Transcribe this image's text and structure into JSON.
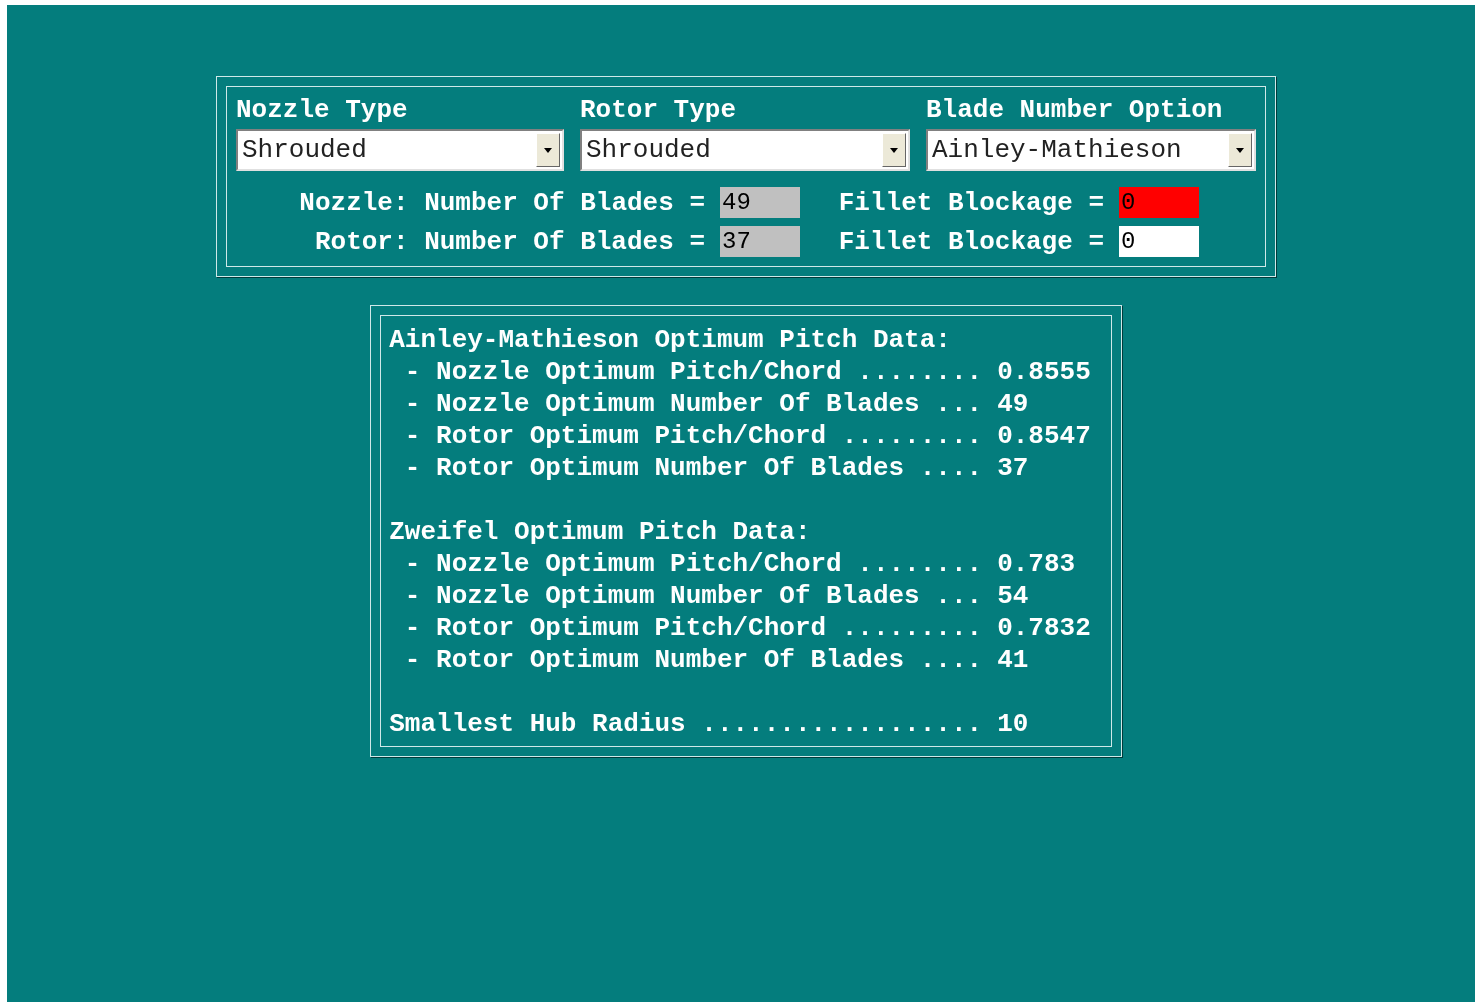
{
  "selectors": [
    {
      "label": "Nozzle Type",
      "value": "Shrouded"
    },
    {
      "label": "Rotor Type",
      "value": "Shrouded"
    },
    {
      "label": "Blade Number Option",
      "value": "Ainley-Mathieson"
    }
  ],
  "blade_rows": [
    {
      "label": "Nozzle: Number Of Blades =",
      "blades": {
        "value": "49",
        "disabled": true
      },
      "fillet_label": "Fillet Blockage =",
      "fillet": {
        "value": "0",
        "error": true
      }
    },
    {
      "label": "Rotor: Number Of Blades =",
      "blades": {
        "value": "37",
        "disabled": true
      },
      "fillet_label": "Fillet Blockage =",
      "fillet": {
        "value": "0",
        "error": false
      }
    }
  ],
  "results": {
    "sections": [
      {
        "title": "Ainley-Mathieson Optimum Pitch Data:",
        "rows": [
          {
            "label": "- Nozzle Optimum Pitch/Chord ........",
            "value": "0.8555"
          },
          {
            "label": "- Nozzle Optimum Number Of Blades ...",
            "value": "49"
          },
          {
            "label": "- Rotor Optimum Pitch/Chord .........",
            "value": "0.8547"
          },
          {
            "label": "- Rotor Optimum Number Of Blades ....",
            "value": "37"
          }
        ]
      },
      {
        "title": "Zweifel Optimum Pitch Data:",
        "rows": [
          {
            "label": "- Nozzle Optimum Pitch/Chord ........",
            "value": "0.783"
          },
          {
            "label": "- Nozzle Optimum Number Of Blades ...",
            "value": "54"
          },
          {
            "label": "- Rotor Optimum Pitch/Chord .........",
            "value": "0.7832"
          },
          {
            "label": "- Rotor Optimum Number Of Blades ....",
            "value": "41"
          }
        ]
      }
    ],
    "footer": {
      "label": "Smallest Hub Radius ..................",
      "value": "10"
    }
  }
}
